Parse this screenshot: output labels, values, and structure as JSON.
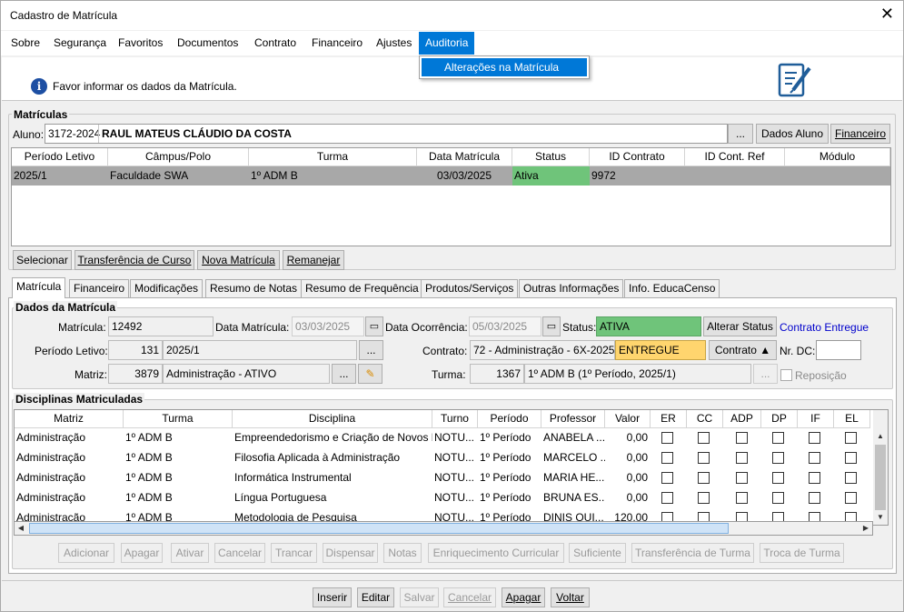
{
  "window": {
    "title": "Cadastro de Matrícula",
    "close": "✕"
  },
  "menu": [
    "Sobre",
    "Segurança",
    "Favoritos",
    "Documentos",
    "Contrato",
    "Financeiro",
    "Ajustes",
    "Auditoria"
  ],
  "dropdown_item": "Alterações na Matrícula",
  "info_text": "Favor informar os dados da Matrícula.",
  "matriculas": {
    "title": "Matrículas",
    "aluno_label": "Aluno:",
    "aluno_code": "3172-2024",
    "aluno_name": "RAUL MATEUS CLÁUDIO DA COSTA",
    "ellipsis": "...",
    "btn_dados": "Dados Aluno",
    "btn_financeiro": "Financeiro",
    "columns": [
      "Período Letivo",
      "Câmpus/Polo",
      "Turma",
      "Data Matrícula",
      "Status",
      "ID Contrato",
      "ID Cont. Ref",
      "Módulo"
    ],
    "row": {
      "periodo": "2025/1",
      "campus": "Faculdade SWA",
      "turma": "1º ADM B",
      "data": "03/03/2025",
      "status": "Ativa",
      "contrato": "9972",
      "ref": "",
      "modulo": ""
    },
    "btn_selecionar": "Selecionar",
    "btn_transferencia": "Transferência de Curso",
    "btn_nova": "Nova Matrícula",
    "btn_remanejar": "Remanejar"
  },
  "tabs": [
    "Matrícula",
    "Financeiro",
    "Modificações",
    "Resumo de Notas",
    "Resumo de Frequência",
    "Produtos/Serviços",
    "Outras Informações",
    "Info. EducaCenso"
  ],
  "dados": {
    "title": "Dados da Matrícula",
    "matricula_label": "Matrícula:",
    "matricula": "12492",
    "data_mat_label": "Data Matrícula:",
    "data_mat": "03/03/2025",
    "data_oc_label": "Data Ocorrência:",
    "data_oc": "05/03/2025",
    "status_label": "Status:",
    "status": "ATIVA",
    "btn_alterar": "Alterar Status",
    "contrato_entregue": "Contrato Entregue",
    "periodo_label": "Período Letivo:",
    "periodo_code": "131",
    "periodo": "2025/1",
    "contrato_label": "Contrato:",
    "contrato": "72 - Administração - 6X-2025",
    "contrato_status": "ENTREGUE",
    "btn_contrato": "Contrato ▲",
    "nrdc_label": "Nr. DC:",
    "matriz_label": "Matriz:",
    "matriz_code": "3879",
    "matriz": "Administração - ATIVO",
    "turma_label": "Turma:",
    "turma_code": "1367",
    "turma": "1º ADM B (1º Período, 2025/1)",
    "reposicao": "Reposição"
  },
  "disciplinas": {
    "title": "Disciplinas Matriculadas",
    "columns": [
      "Matriz",
      "Turma",
      "Disciplina",
      "Turno",
      "Período",
      "Professor",
      "Valor",
      "ER",
      "CC",
      "ADP",
      "DP",
      "IF",
      "EL"
    ],
    "rows": [
      [
        "Administração",
        "1º ADM B",
        "Empreendedorismo e Criação de Novos N",
        "NOTU...",
        "1º Período",
        "ANABELA ...",
        "0,00"
      ],
      [
        "Administração",
        "1º ADM B",
        "Filosofia Aplicada à Administração",
        "NOTU...",
        "1º Período",
        "MARCELO ...",
        "0,00"
      ],
      [
        "Administração",
        "1º ADM B",
        "Informática Instrumental",
        "NOTU...",
        "1º Período",
        "MARIA HE...",
        "0,00"
      ],
      [
        "Administração",
        "1º ADM B",
        "Língua Portuguesa",
        "NOTU...",
        "1º Período",
        "BRUNA ES...",
        "0,00"
      ],
      [
        "Administração",
        "1º ADM B",
        "Metodologia de Pesquisa",
        "NOTU...",
        "1º Período",
        "DINIS QUI...",
        "120,00"
      ]
    ],
    "actions": [
      "Adicionar",
      "Apagar",
      "Ativar",
      "Cancelar",
      "Trancar",
      "Dispensar",
      "Notas",
      "Enriquecimento Curricular",
      "Suficiente",
      "Transferência de Turma",
      "Troca de Turma"
    ]
  },
  "footer": [
    "Inserir",
    "Editar",
    "Salvar",
    "Cancelar",
    "Apagar",
    "Voltar"
  ]
}
